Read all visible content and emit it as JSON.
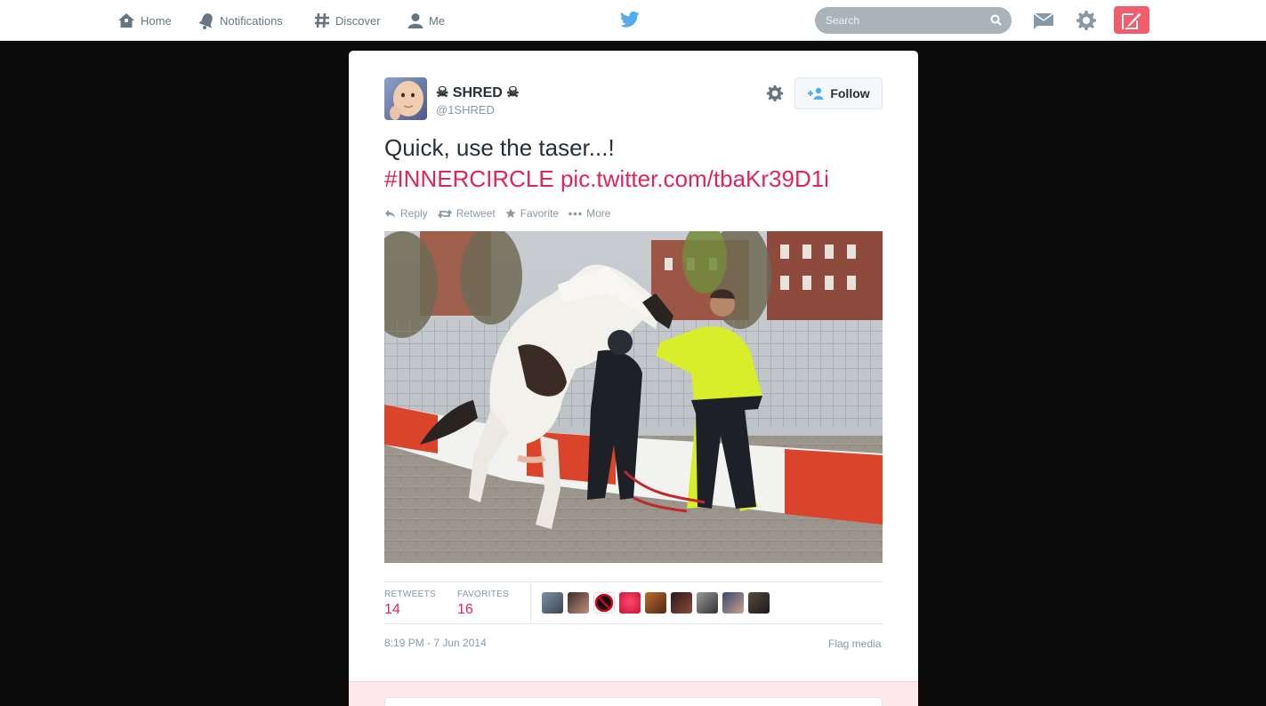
{
  "nav": {
    "items": [
      {
        "label": "Home",
        "icon": "home-icon"
      },
      {
        "label": "Notifications",
        "icon": "bell-icon"
      },
      {
        "label": "Discover",
        "icon": "hashtag-icon"
      },
      {
        "label": "Me",
        "icon": "person-icon"
      }
    ],
    "search_placeholder": "Search",
    "brand_icon": "twitter-bird-icon",
    "right_icons": [
      "envelope-icon",
      "gear-icon",
      "compose-icon"
    ]
  },
  "tweet": {
    "fullname": "☠ SHRED ☠",
    "username": "@1SHRED",
    "follow_label": "Follow",
    "text": "Quick, use the taser...! ",
    "hashtag": "#INNERCIRCLE",
    "pic_link": "pic.twitter.com/tbaKr39D1i",
    "actions": [
      {
        "label": "Reply",
        "icon": "reply-icon"
      },
      {
        "label": "Retweet",
        "icon": "retweet-icon"
      },
      {
        "label": "Favorite",
        "icon": "star-icon"
      },
      {
        "label": "More",
        "icon": "more-dots-icon"
      }
    ],
    "stats": {
      "retweets_label": "RETWEETS",
      "retweets": "14",
      "favorites_label": "FAVORITES",
      "favorites": "16"
    },
    "timestamp": "8:19 PM - 7 Jun 2014",
    "flag_label": "Flag media"
  },
  "colors": {
    "accent": "#e0245e",
    "compose_bg": "#ef5d6e",
    "brand_blue": "#55acee",
    "muted": "#8899a6"
  }
}
